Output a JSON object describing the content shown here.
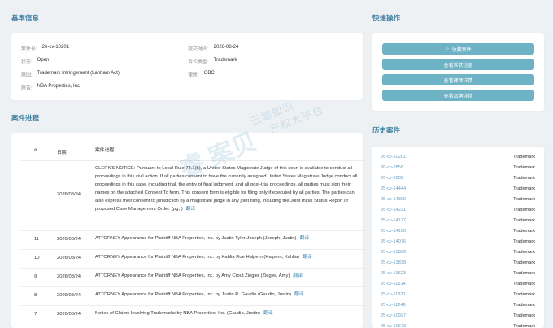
{
  "basic": {
    "title": "基本信息",
    "case_no_label": "案件号:",
    "case_no": "26-cv-10201",
    "filed_label": "提交时间:",
    "filed": "2026-08-24",
    "status_label": "状态:",
    "status": "Open",
    "type_label": "诉讼类型:",
    "type": "Trademark",
    "cause_label": "原因:",
    "cause": "Trademark Infringement (Lanham Act)",
    "brand_label": "律所:",
    "brand": "GBC",
    "plaintiff_label": "原告:",
    "plaintiff": "NBA Properties, Inc"
  },
  "quick": {
    "title": "快速操作",
    "buttons": [
      "收藏案件",
      "查看诉状信息",
      "查看律师详情",
      "查看品牌详情"
    ]
  },
  "progress": {
    "title": "案件进程",
    "headers": [
      "#",
      "日期",
      "案件进程"
    ],
    "rows": [
      {
        "no": "",
        "date": "2026/08/24",
        "desc": "CLERK'S NOTICE: Pursuant to Local Rule 73.1(b), a United States Magistrate Judge of this court is available to conduct all proceedings in this civil action. If all parties consent to have the currently assigned United States Magistrate Judge conduct all proceedings in this case, including trial, the entry of final judgment, and all post-trial proceedings, all parties must sign their names on the attached Consent To form. This consent form is eligible for filing only if executed by all parties. The parties can also express their consent to jurisdiction by a magistrate judge in any joint filing, including the Joint Initial Status Report or proposed Case Management Order. (pg, )",
        "link": "翻译"
      },
      {
        "no": "11",
        "date": "2026/08/24",
        "desc": "ATTORNEY Appearance for Plaintiff NBA Properties, Inc. by Justin Tyler Joseph (Joseph, Justin)",
        "link": "翻译"
      },
      {
        "no": "10",
        "date": "2026/08/24",
        "desc": "ATTORNEY Appearance for Plaintiff NBA Properties, Inc. by Kahlia Roe Halpern (Halpern, Kahlia)",
        "link": "翻译"
      },
      {
        "no": "9",
        "date": "2026/08/24",
        "desc": "ATTORNEY Appearance for Plaintiff NBA Properties, Inc. by Amy Crout Ziegler (Ziegler, Amy)",
        "link": "翻译"
      },
      {
        "no": "8",
        "date": "2026/08/24",
        "desc": "ATTORNEY Appearance for Plaintiff NBA Properties, Inc. by Justin R. Gaudio (Gaudio, Justin)",
        "link": "翻译"
      },
      {
        "no": "7",
        "date": "2026/08/24",
        "desc": "Notice of Claims Involving Trademarks by NBA Properties, Inc. (Gaudio, Justin)",
        "link": "翻译"
      }
    ]
  },
  "history": {
    "title": "历史案件",
    "rows": [
      {
        "case": "26-cv-10201",
        "type": "Trademark"
      },
      {
        "case": "26-cv-2858",
        "type": "Trademark"
      },
      {
        "case": "26-cv-2802",
        "type": "Trademark"
      },
      {
        "case": "25-cv-14444",
        "type": "Trademark"
      },
      {
        "case": "25-cv-14399",
        "type": "Trademark"
      },
      {
        "case": "25-cv-14221",
        "type": "Trademark"
      },
      {
        "case": "25-cv-14177",
        "type": "Trademark"
      },
      {
        "case": "25-cv-14108",
        "type": "Trademark"
      },
      {
        "case": "25-cv-14076",
        "type": "Trademark"
      },
      {
        "case": "25-cv-13899",
        "type": "Trademark"
      },
      {
        "case": "25-cv-13838",
        "type": "Trademark"
      },
      {
        "case": "25-cv-13623",
        "type": "Trademark"
      },
      {
        "case": "25-cv-11614",
        "type": "Trademark"
      },
      {
        "case": "25-cv-11321",
        "type": "Trademark"
      },
      {
        "case": "25-cv-11246",
        "type": "Trademark"
      },
      {
        "case": "25-cv-10927",
        "type": "Trademark"
      },
      {
        "case": "25-cv-10673",
        "type": "Trademark"
      }
    ]
  },
  "watermark": {
    "main": "睿 案贝",
    "sub1": "云端知识",
    "sub2": "产权大平台"
  },
  "colors": {
    "accent": "#3f7f9f",
    "button": "#6eb2c6",
    "link": "#3f88b5"
  }
}
